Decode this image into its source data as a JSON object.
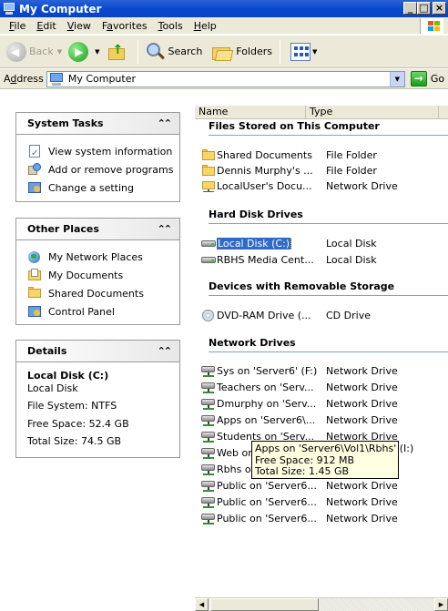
{
  "window": {
    "title": "My Computer"
  },
  "menu": {
    "file": {
      "key": "F",
      "rest": "ile"
    },
    "edit": {
      "key": "E",
      "rest": "dit"
    },
    "view": {
      "key": "V",
      "rest": "iew"
    },
    "favorites": {
      "pre": "F",
      "key": "a",
      "rest": "vorites"
    },
    "tools": {
      "key": "T",
      "rest": "ools"
    },
    "help": {
      "key": "H",
      "rest": "elp"
    }
  },
  "toolbar": {
    "back_label": "Back",
    "search_label": "Search",
    "folders_label": "Folders"
  },
  "address": {
    "label_key": "d",
    "label_pre": "A",
    "label_rest": "dress",
    "value": "My Computer",
    "go_label": "Go"
  },
  "system_tasks": {
    "title": "System Tasks",
    "items": [
      "View system information",
      "Add or remove programs",
      "Change a setting"
    ]
  },
  "other_places": {
    "title": "Other Places",
    "items": [
      "My Network Places",
      "My Documents",
      "Shared Documents",
      "Control Panel"
    ]
  },
  "details": {
    "title": "Details",
    "name": "Local Disk (C:)",
    "type": "Local Disk",
    "file_system": "File System: NTFS",
    "free_space": "Free Space: 52.4 GB",
    "total_size": "Total Size: 74.5 GB"
  },
  "columns": {
    "name": "Name",
    "type": "Type"
  },
  "groups": {
    "files_stored": {
      "title": "Files Stored on This Computer",
      "items": [
        {
          "name": "Shared Documents",
          "type": "File Folder"
        },
        {
          "name": "Dennis Murphy's ...",
          "type": "File Folder"
        },
        {
          "name": "LocalUser's Docu...",
          "type": "Network Drive"
        }
      ]
    },
    "hard_disks": {
      "title": "Hard Disk Drives",
      "items": [
        {
          "name": "Local Disk (C:)",
          "type": "Local Disk"
        },
        {
          "name": "RBHS Media Cent...",
          "type": "Local Disk"
        }
      ]
    },
    "removable": {
      "title": "Devices with Removable Storage",
      "items": [
        {
          "name": "DVD-RAM Drive (...",
          "type": "CD Drive"
        }
      ]
    },
    "network": {
      "title": "Network Drives",
      "items": [
        {
          "name": "Sys on 'Server6' (F:)",
          "type": "Network Drive"
        },
        {
          "name": "Teachers on 'Serv...",
          "type": "Network Drive"
        },
        {
          "name": "Dmurphy on 'Serv...",
          "type": "Network Drive"
        },
        {
          "name": "Apps on 'Server6\\...",
          "type": "Network Drive"
        },
        {
          "name": "Students on 'Serv...",
          "type": "Network Drive"
        },
        {
          "name": "Web on",
          "type": ""
        },
        {
          "name": "Rbhs o",
          "type": ""
        },
        {
          "name": "Public on 'Server6...",
          "type": "Network Drive"
        },
        {
          "name": "Public on 'Server6...",
          "type": "Network Drive"
        },
        {
          "name": "Public on 'Server6...",
          "type": "Network Drive"
        }
      ]
    }
  },
  "tooltip": {
    "line1": "Apps on 'Server6\\Vol1\\Rbhs' (I:)",
    "line2": "Free Space: 912 MB",
    "line3": "Total Size: 1.45 GB"
  },
  "colors": {
    "title_blue": "#0a4ad0",
    "selection": "#316ac5",
    "group_line": "#7fa0d8"
  }
}
